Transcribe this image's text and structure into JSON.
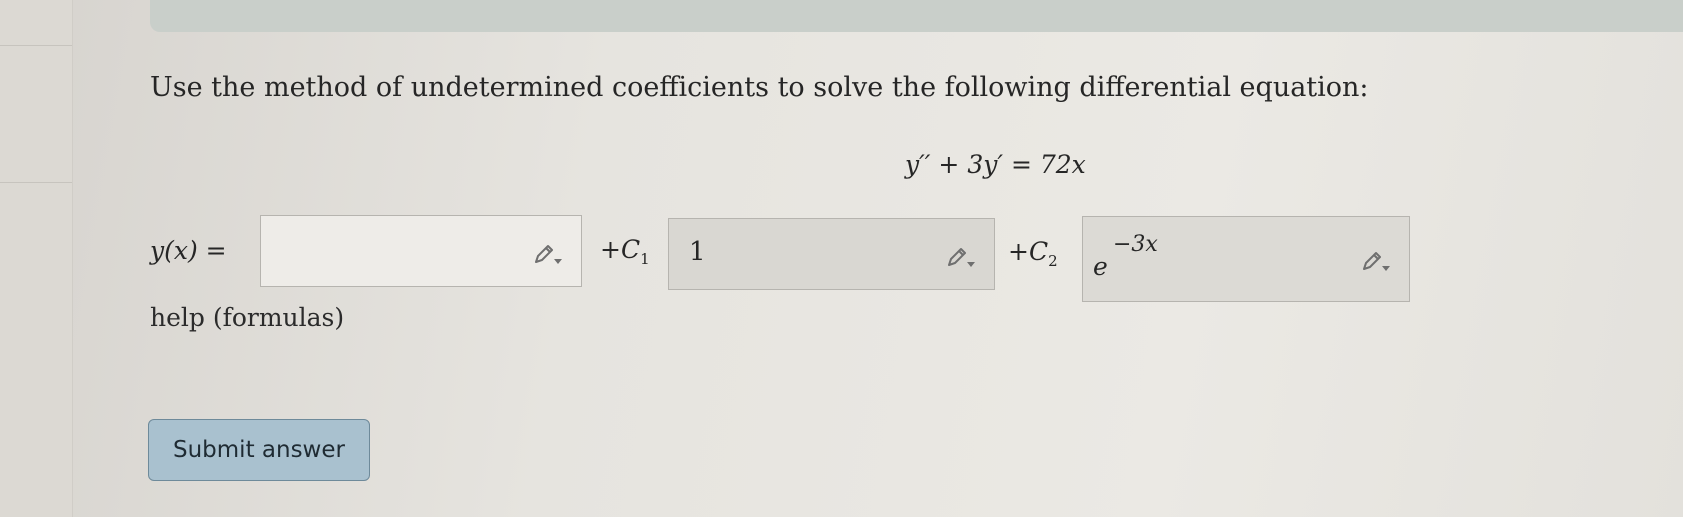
{
  "question": {
    "instruction": "Use the method of undetermined coefficients to solve the following differential equation:",
    "equation": "y′′ + 3y′ = 72x",
    "lhs_label": "y(x) ="
  },
  "answer": {
    "field_1": {
      "value": ""
    },
    "constant_1": {
      "prefix": "+C",
      "subscript": "1"
    },
    "field_2": {
      "value": "1"
    },
    "constant_2": {
      "prefix": "+C",
      "subscript": "2"
    },
    "field_3": {
      "base": "e",
      "exponent": "−3x"
    },
    "edit_icon": "pencil-dropdown-icon"
  },
  "help": {
    "label": "help (formulas)"
  },
  "submit": {
    "label": "Submit answer"
  },
  "colors": {
    "submit_button": "#a9c1cf",
    "top_bar": "#c9cfca"
  }
}
